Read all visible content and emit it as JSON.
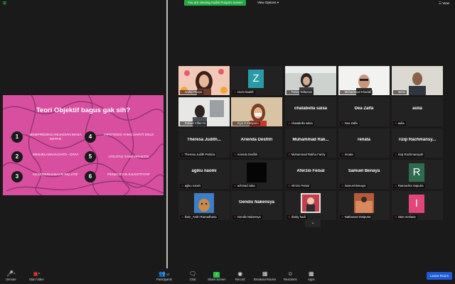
{
  "topbar": {
    "viewing_text": "You are viewing Andini Puspa's screen",
    "view_options_label": "View Options",
    "view_label": "View"
  },
  "slide": {
    "title": "Teori Objektif bagus gak sih?",
    "items": [
      {
        "num": "1",
        "text": "MEMPREDIKSI KEJADIAN MASA DEPAN"
      },
      {
        "num": "2",
        "text": "MENJELASKAN DATA - DATA"
      },
      {
        "num": "3",
        "text": "KESEDERHANAAN RELATIF"
      },
      {
        "num": "4",
        "text": "HIPOTESIS YANG DAPAT DIUJI"
      },
      {
        "num": "5",
        "text": "UTILITAS YANG PRAKTIS"
      },
      {
        "num": "6",
        "text": "PENELITIAN KUANTITATIF"
      }
    ]
  },
  "participants": [
    {
      "name": "Andini Puspa",
      "center": "",
      "letter": ""
    },
    {
      "name": "zoom baa0ê",
      "center": "",
      "letter": "Z"
    },
    {
      "name": "Farizy Taftazani",
      "center": "",
      "letter": ""
    },
    {
      "name": "Muhammad Khadafi",
      "center": "",
      "letter": ""
    },
    {
      "name": "asrari",
      "center": "",
      "letter": ""
    },
    {
      "name": "Rafiael Clifert N",
      "center": "",
      "letter": ""
    },
    {
      "name": "Aryo S Eddyono",
      "center": "",
      "letter": ""
    },
    {
      "name": "chatabella salsa",
      "center": "chatabella salsa",
      "letter": ""
    },
    {
      "name": "Dea Zalfa",
      "center": "Dea Zalfa",
      "letter": ""
    },
    {
      "name": "aulia",
      "center": "aulia",
      "letter": ""
    },
    {
      "name": "Theresa Judith Patricia",
      "center": "Theresa Judith...",
      "letter": ""
    },
    {
      "name": "Arienda Desfitri",
      "center": "Arienda Desfitri",
      "letter": ""
    },
    {
      "name": "Muhammad Rakha Farizy",
      "center": "Muhammad Rak...",
      "letter": ""
    },
    {
      "name": "renata",
      "center": "renata",
      "letter": ""
    },
    {
      "name": "rizqi Rachmansyah",
      "center": "rizqi Rachmansy...",
      "letter": ""
    },
    {
      "name": "agiku naomi",
      "center": "agiku naomi",
      "letter": ""
    },
    {
      "name": "achmad zaka",
      "center": "",
      "letter": ""
    },
    {
      "name": "Aferzio Feisal",
      "center": "Aferzio Feisal",
      "letter": ""
    },
    {
      "name": "Samuel Benaya",
      "center": "Samuel Benaya",
      "letter": ""
    },
    {
      "name": "Ramaezka Saputra",
      "center": "",
      "letter": "R"
    },
    {
      "name": "ikom_Andri Ramadhana",
      "center": "",
      "letter": ""
    },
    {
      "name": "Gendis Nakensya",
      "center": "Gendis Nakensya",
      "letter": ""
    },
    {
      "name": "dzaky hadi",
      "center": "",
      "letter": ""
    },
    {
      "name": "Nathanael Dwiputra",
      "center": "",
      "letter": ""
    },
    {
      "name": "intan meliana",
      "center": "",
      "letter": "I"
    }
  ],
  "toolbar": {
    "unmute": "Unmute",
    "start_video": "Start Video",
    "participants": "Participants",
    "participants_count": "37",
    "chat": "Chat",
    "share_screen": "Share Screen",
    "record": "Record",
    "breakout": "Breakout Rooms",
    "reactions": "Reactions",
    "apps": "Apps",
    "leave": "Leave Room"
  },
  "colors": {
    "slide_bg": "#d84fa0",
    "share_green": "#27a745",
    "leave_blue": "#1f5bd6",
    "active_speaker": "#b6e14a"
  }
}
